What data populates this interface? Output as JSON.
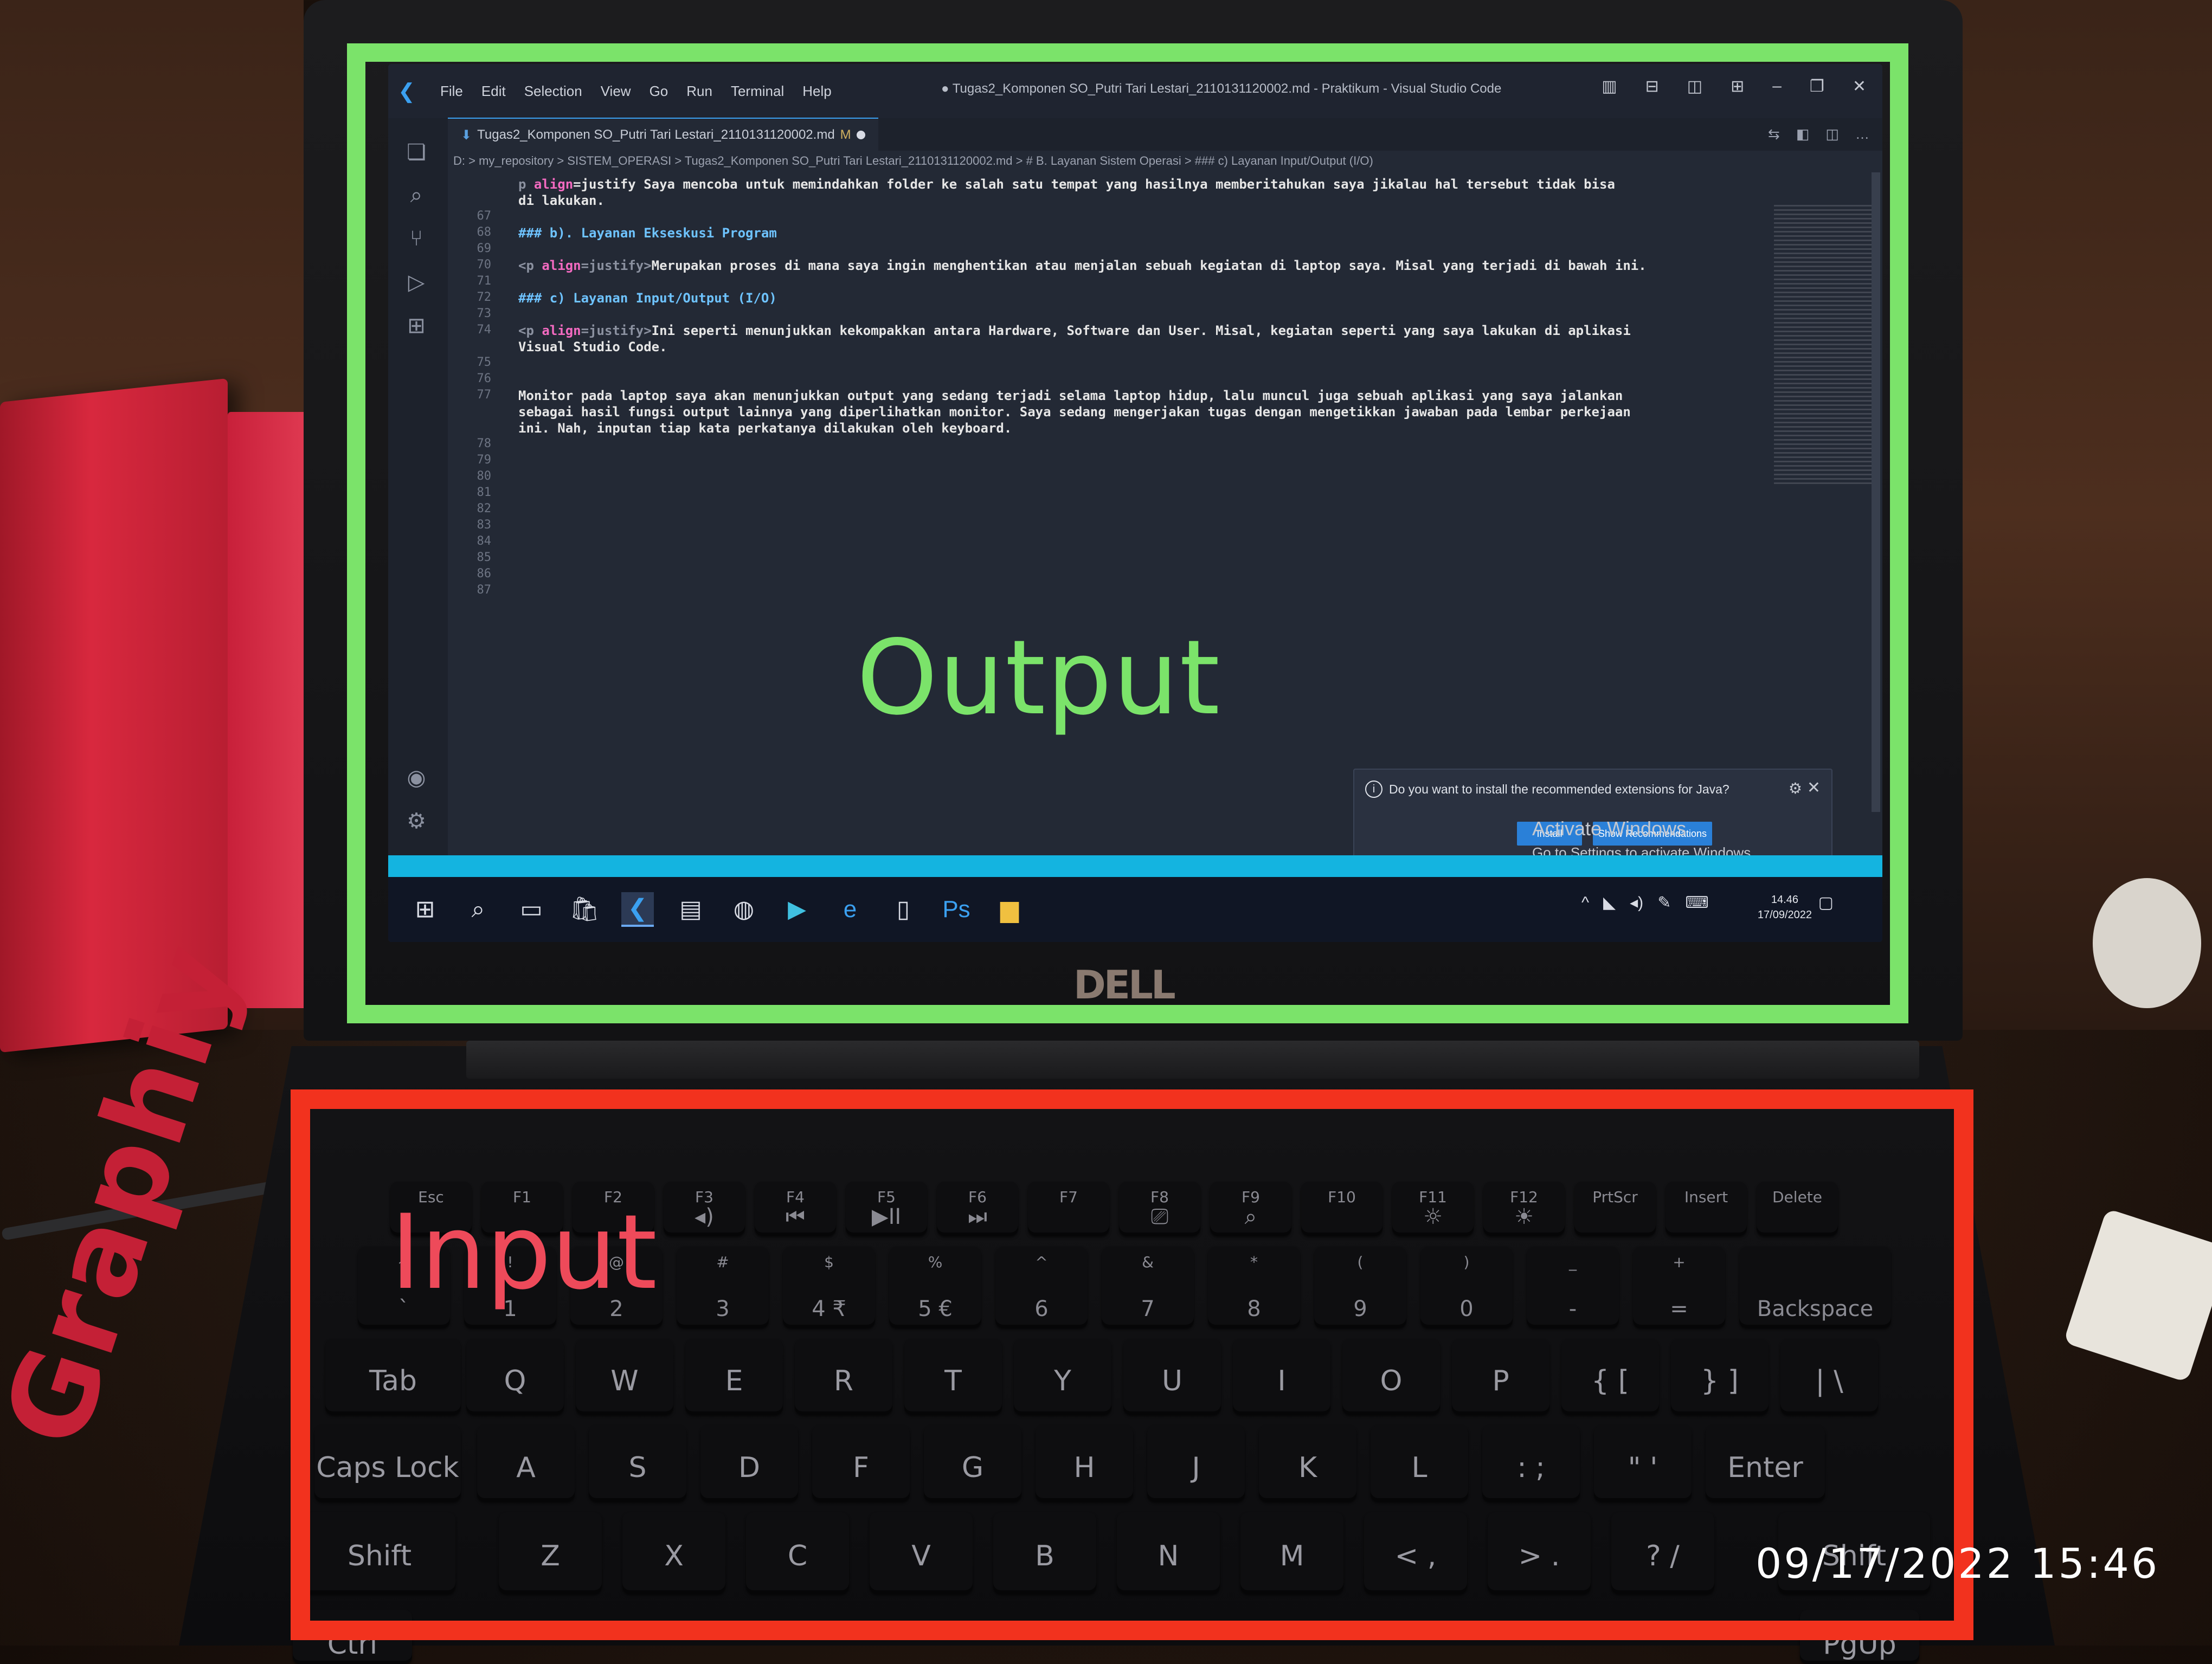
{
  "overlay": {
    "output_label": "Output",
    "input_label": "Input",
    "timestamp": "09/17/2022  15:46",
    "output_frame_color": "#7be36a",
    "input_frame_color": "#f2321e"
  },
  "laptop": {
    "brand": "DELL"
  },
  "background": {
    "book_text": "Graphiy"
  },
  "vscode": {
    "menu": [
      "File",
      "Edit",
      "Selection",
      "View",
      "Go",
      "Run",
      "Terminal",
      "Help"
    ],
    "window_title": "● Tugas2_Komponen SO_Putri Tari Lestari_2110131120002.md - Praktikum - Visual Studio Code",
    "tab_label": "Tugas2_Komponen SO_Putri Tari Lestari_2110131120002.md",
    "tab_status": "M",
    "breadcrumb": "D: > my_repository > SISTEM_OPERASI > Tugas2_Komponen SO_Putri Tari Lestari_2110131120002.md > # B. Layanan Sistem Operasi > ### c) Layanan Input/Output (I/O)",
    "lines": [
      {
        "n": "",
        "parts": [
          {
            "t": "p ",
            "c": "tag"
          },
          {
            "t": "align",
            "c": "attr"
          },
          {
            "t": "=justify ",
            "c": "plain"
          },
          {
            "t": "Saya mencoba untuk memindahkan folder ke salah satu tempat yang hasilnya memberitahukan saya jikalau hal tersebut tidak bisa",
            "c": "plain"
          }
        ]
      },
      {
        "n": "",
        "parts": [
          {
            "t": "di lakukan.",
            "c": "plain"
          }
        ]
      },
      {
        "n": "67",
        "parts": []
      },
      {
        "n": "68",
        "parts": [
          {
            "t": "### b). Layanan Ekseskusi Program",
            "c": "heading"
          }
        ]
      },
      {
        "n": "69",
        "parts": []
      },
      {
        "n": "70",
        "parts": [
          {
            "t": "<p ",
            "c": "tag"
          },
          {
            "t": "align",
            "c": "attr"
          },
          {
            "t": "=justify>",
            "c": "tag"
          },
          {
            "t": "Merupakan proses di mana saya ingin menghentikan atau menjalan sebuah kegiatan di laptop saya. Misal yang terjadi di bawah ini.",
            "c": "plain"
          }
        ]
      },
      {
        "n": "71",
        "parts": []
      },
      {
        "n": "72",
        "parts": [
          {
            "t": "### c) Layanan Input/Output (I/O)",
            "c": "heading"
          }
        ]
      },
      {
        "n": "73",
        "parts": []
      },
      {
        "n": "74",
        "parts": [
          {
            "t": "<p ",
            "c": "tag"
          },
          {
            "t": "align",
            "c": "attr"
          },
          {
            "t": "=justify>",
            "c": "tag"
          },
          {
            "t": "Ini seperti menunjukkan kekompakkan antara Hardware, Software dan User. Misal, kegiatan seperti yang saya lakukan di aplikasi",
            "c": "plain"
          }
        ]
      },
      {
        "n": "",
        "parts": [
          {
            "t": "Visual Studio Code.",
            "c": "plain"
          }
        ]
      },
      {
        "n": "75",
        "parts": []
      },
      {
        "n": "76",
        "parts": []
      },
      {
        "n": "77",
        "parts": [
          {
            "t": "Monitor pada laptop saya akan menunjukkan output yang sedang terjadi selama laptop hidup, lalu muncul juga sebuah aplikasi yang saya jalankan",
            "c": "plain"
          }
        ]
      },
      {
        "n": "",
        "parts": [
          {
            "t": "sebagai hasil fungsi output lainnya yang diperlihatkan monitor. Saya sedang mengerjakan tugas dengan mengetikkan jawaban pada lembar perkejaan",
            "c": "plain"
          }
        ]
      },
      {
        "n": "",
        "parts": [
          {
            "t": "ini. Nah, inputan tiap kata perkatanya dilakukan oleh keyboard.",
            "c": "plain"
          }
        ]
      },
      {
        "n": "78",
        "parts": []
      },
      {
        "n": "79",
        "parts": []
      },
      {
        "n": "80",
        "parts": []
      },
      {
        "n": "81",
        "parts": []
      },
      {
        "n": "82",
        "parts": []
      },
      {
        "n": "83",
        "parts": []
      },
      {
        "n": "84",
        "parts": []
      },
      {
        "n": "85",
        "parts": []
      },
      {
        "n": "86",
        "parts": []
      },
      {
        "n": "87",
        "parts": []
      }
    ],
    "notification": {
      "message": "Do you want to install the recommended extensions for Java?",
      "install_label": "Install",
      "show_label": "Show Recommendations"
    },
    "activate_windows": {
      "line1": "Activate Windows",
      "line2": "Go to Settings to activate Windows."
    },
    "clock": {
      "time": "14.46",
      "date": "17/09/2022"
    }
  },
  "keyboard": {
    "fn_row": [
      {
        "main": "Esc",
        "sub": ""
      },
      {
        "main": "F1",
        "sub": ""
      },
      {
        "main": "F2",
        "sub": ""
      },
      {
        "main": "F3",
        "sub": "◂)"
      },
      {
        "main": "F4",
        "sub": "⏮"
      },
      {
        "main": "F5",
        "sub": "▶II"
      },
      {
        "main": "F6",
        "sub": "⏭"
      },
      {
        "main": "F7",
        "sub": ""
      },
      {
        "main": "F8",
        "sub": "⎚"
      },
      {
        "main": "F9",
        "sub": "⌕"
      },
      {
        "main": "F10",
        "sub": ""
      },
      {
        "main": "F11",
        "sub": "☼"
      },
      {
        "main": "F12",
        "sub": "☀"
      },
      {
        "main": "PrtScr",
        "sub": ""
      },
      {
        "main": "Insert",
        "sub": ""
      },
      {
        "main": "Delete",
        "sub": ""
      }
    ],
    "num_row": [
      {
        "top": "~",
        "bot": "`"
      },
      {
        "top": "!",
        "bot": "1"
      },
      {
        "top": "@",
        "bot": "2"
      },
      {
        "top": "#",
        "bot": "3"
      },
      {
        "top": "$",
        "bot": "4  ₹"
      },
      {
        "top": "%",
        "bot": "5  €"
      },
      {
        "top": "^",
        "bot": "6"
      },
      {
        "top": "&",
        "bot": "7"
      },
      {
        "top": "*",
        "bot": "8"
      },
      {
        "top": "(",
        "bot": "9"
      },
      {
        "top": ")",
        "bot": "0"
      },
      {
        "top": "_",
        "bot": "-"
      },
      {
        "top": "+",
        "bot": "="
      },
      {
        "top": "",
        "bot": "Backspace"
      }
    ],
    "q_row": [
      "Tab",
      "Q",
      "W",
      "E",
      "R",
      "T",
      "Y",
      "U",
      "I",
      "O",
      "P",
      "{ [",
      "} ]",
      "| \\"
    ],
    "a_row": [
      "Caps Lock",
      "A",
      "S",
      "D",
      "F",
      "G",
      "H",
      "J",
      "K",
      "L",
      ": ;",
      "\" '",
      "Enter"
    ],
    "z_row": [
      "Shift",
      "Z",
      "X",
      "C",
      "V",
      "B",
      "N",
      "M",
      "< ,",
      "> .",
      "? /",
      "Shift"
    ],
    "bottom_row": [
      "Ctrl",
      "PgUp"
    ]
  }
}
